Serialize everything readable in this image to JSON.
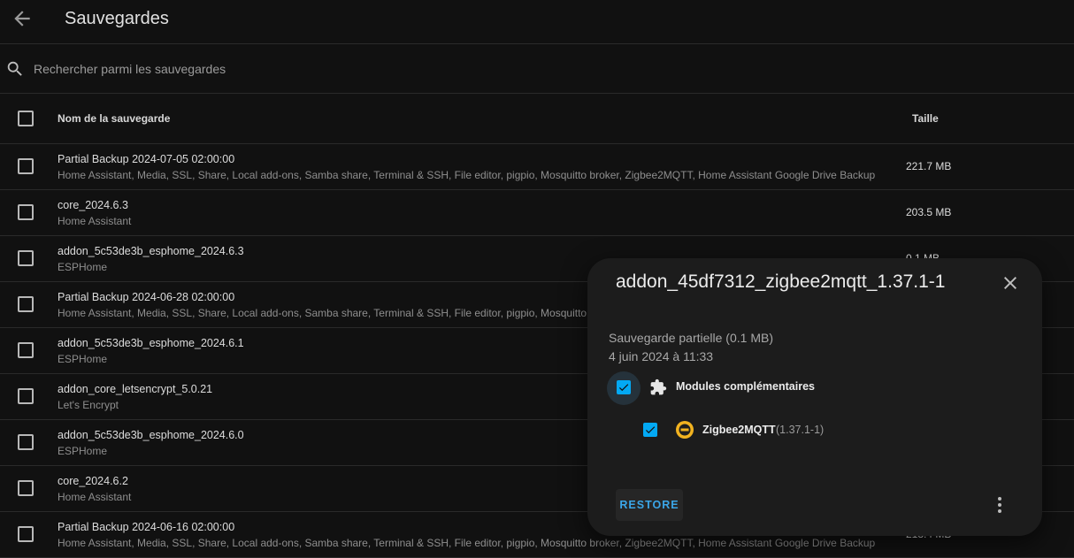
{
  "header": {
    "title": "Sauvegardes",
    "back_icon": "arrow-left-icon"
  },
  "search": {
    "placeholder": "Rechercher parmi les sauvegardes",
    "icon": "search-icon"
  },
  "table": {
    "columns": {
      "name": "Nom de la sauvegarde",
      "size": "Taille"
    },
    "rows": [
      {
        "name": "Partial Backup 2024-07-05 02:00:00",
        "sub": "Home Assistant, Media, SSL, Share, Local add-ons, Samba share, Terminal & SSH, File editor, pigpio, Mosquitto broker, Zigbee2MQTT, Home Assistant Google Drive Backup",
        "size": "221.7 MB"
      },
      {
        "name": "core_2024.6.3",
        "sub": "Home Assistant",
        "size": "203.5 MB"
      },
      {
        "name": "addon_5c53de3b_esphome_2024.6.3",
        "sub": "ESPHome",
        "size": "0.1 MB"
      },
      {
        "name": "Partial Backup 2024-06-28 02:00:00",
        "sub": "Home Assistant, Media, SSL, Share, Local add-ons, Samba share, Terminal & SSH, File editor, pigpio, Mosquitto broker, Zigbee2MQTT, Home Assistant Google Drive Backup",
        "size": ""
      },
      {
        "name": "addon_5c53de3b_esphome_2024.6.1",
        "sub": "ESPHome",
        "size": ""
      },
      {
        "name": "addon_core_letsencrypt_5.0.21",
        "sub": "Let's Encrypt",
        "size": ""
      },
      {
        "name": "addon_5c53de3b_esphome_2024.6.0",
        "sub": "ESPHome",
        "size": ""
      },
      {
        "name": "core_2024.6.2",
        "sub": "Home Assistant",
        "size": ""
      },
      {
        "name": "Partial Backup 2024-06-16 02:00:00",
        "sub": "Home Assistant, Media, SSL, Share, Local add-ons, Samba share, Terminal & SSH, File editor, pigpio, Mosquitto broker, Zigbee2MQTT, Home Assistant Google Drive Backup",
        "size": "218.4 MB"
      }
    ]
  },
  "dialog": {
    "title": "addon_45df7312_zigbee2mqtt_1.37.1-1",
    "type": "Sauvegarde partielle (0.1 MB)",
    "date": "4 juin 2024 à 11:33",
    "addons_label": "Modules complémentaires",
    "addon": {
      "name": "Zigbee2MQTT",
      "version": "(1.37.1-1)"
    },
    "restore_label": "RESTORE"
  },
  "colors": {
    "background": "#111111",
    "dialog": "#1c1c1c",
    "accent": "#03a9f4",
    "restore_text": "#3ba6e8"
  }
}
